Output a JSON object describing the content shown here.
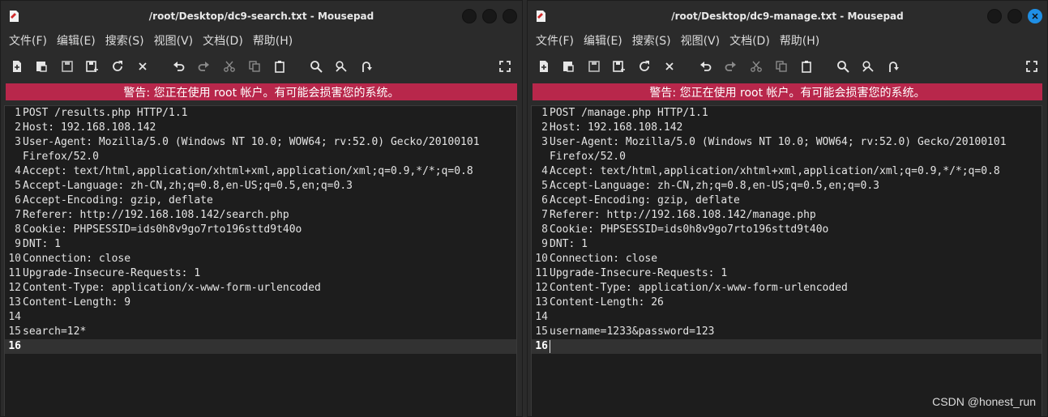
{
  "left_window": {
    "title": "/root/Desktop/dc9-search.txt - Mousepad",
    "menu": [
      "文件(F)",
      "编辑(E)",
      "搜索(S)",
      "视图(V)",
      "文档(D)",
      "帮助(H)"
    ],
    "warning": "警告: 您正在使用 root 帐户。有可能会损害您的系统。",
    "lines": [
      {
        "n": "1",
        "text": "POST /results.php HTTP/1.1"
      },
      {
        "n": "2",
        "text": "Host: 192.168.108.142"
      },
      {
        "n": "3",
        "text": "User-Agent: Mozilla/5.0 (Windows NT 10.0; WOW64; rv:52.0) Gecko/20100101"
      },
      {
        "n": "",
        "text": "Firefox/52.0"
      },
      {
        "n": "4",
        "text": "Accept: text/html,application/xhtml+xml,application/xml;q=0.9,*/*;q=0.8"
      },
      {
        "n": "5",
        "text": "Accept-Language: zh-CN,zh;q=0.8,en-US;q=0.5,en;q=0.3"
      },
      {
        "n": "6",
        "text": "Accept-Encoding: gzip, deflate"
      },
      {
        "n": "7",
        "text": "Referer: http://192.168.108.142/search.php"
      },
      {
        "n": "8",
        "text": "Cookie: PHPSESSID=ids0h8v9go7rto196sttd9t40o"
      },
      {
        "n": "9",
        "text": "DNT: 1"
      },
      {
        "n": "10",
        "text": "Connection: close"
      },
      {
        "n": "11",
        "text": "Upgrade-Insecure-Requests: 1"
      },
      {
        "n": "12",
        "text": "Content-Type: application/x-www-form-urlencoded"
      },
      {
        "n": "13",
        "text": "Content-Length: 9"
      },
      {
        "n": "14",
        "text": ""
      },
      {
        "n": "15",
        "text": "search=12*"
      },
      {
        "n": "16",
        "text": ""
      }
    ]
  },
  "right_window": {
    "title": "/root/Desktop/dc9-manage.txt - Mousepad",
    "menu": [
      "文件(F)",
      "编辑(E)",
      "搜索(S)",
      "视图(V)",
      "文档(D)",
      "帮助(H)"
    ],
    "warning": "警告: 您正在使用 root 帐户。有可能会损害您的系统。",
    "lines": [
      {
        "n": "1",
        "text": "POST /manage.php HTTP/1.1"
      },
      {
        "n": "2",
        "text": "Host: 192.168.108.142"
      },
      {
        "n": "3",
        "text": "User-Agent: Mozilla/5.0 (Windows NT 10.0; WOW64; rv:52.0) Gecko/20100101"
      },
      {
        "n": "",
        "text": "Firefox/52.0"
      },
      {
        "n": "4",
        "text": "Accept: text/html,application/xhtml+xml,application/xml;q=0.9,*/*;q=0.8"
      },
      {
        "n": "5",
        "text": "Accept-Language: zh-CN,zh;q=0.8,en-US;q=0.5,en;q=0.3"
      },
      {
        "n": "6",
        "text": "Accept-Encoding: gzip, deflate"
      },
      {
        "n": "7",
        "text": "Referer: http://192.168.108.142/manage.php"
      },
      {
        "n": "8",
        "text": "Cookie: PHPSESSID=ids0h8v9go7rto196sttd9t40o"
      },
      {
        "n": "9",
        "text": "DNT: 1"
      },
      {
        "n": "10",
        "text": "Connection: close"
      },
      {
        "n": "11",
        "text": "Upgrade-Insecure-Requests: 1"
      },
      {
        "n": "12",
        "text": "Content-Type: application/x-www-form-urlencoded"
      },
      {
        "n": "13",
        "text": "Content-Length: 26"
      },
      {
        "n": "14",
        "text": ""
      },
      {
        "n": "15",
        "text": "username=1233&password=123"
      },
      {
        "n": "16",
        "text": ""
      }
    ]
  },
  "watermark": "CSDN @honest_run",
  "colors": {
    "warning_bg": "#b8274b",
    "close_active": "#1f8fe5"
  },
  "toolbar_icons": [
    "new-document-icon",
    "new-window-icon",
    "save-icon",
    "save-as-icon",
    "reload-icon",
    "close-tab-icon",
    "undo-icon",
    "redo-icon",
    "cut-icon",
    "copy-icon",
    "paste-icon",
    "find-icon",
    "find-replace-icon",
    "go-to-line-icon",
    "fullscreen-icon"
  ]
}
